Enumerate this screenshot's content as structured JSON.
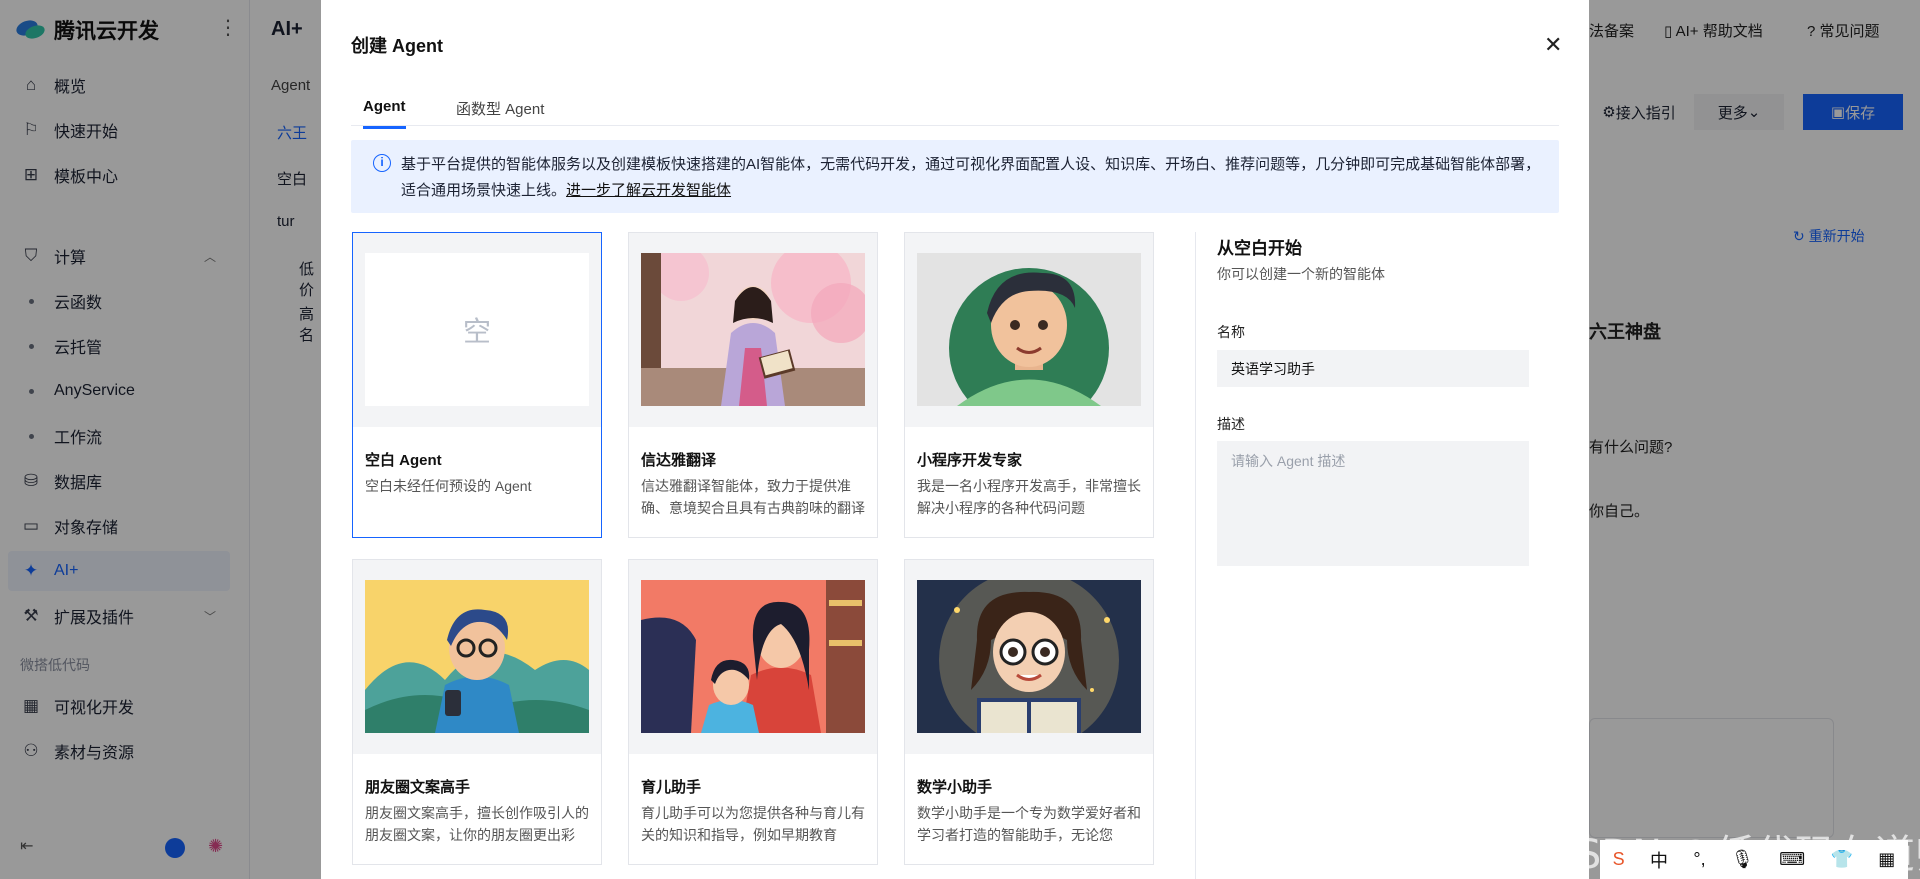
{
  "sidebar": {
    "brand": "腾讯云开发",
    "items": [
      {
        "label": "概览",
        "icon": "home-icon"
      },
      {
        "label": "快速开始",
        "icon": "flag-icon"
      },
      {
        "label": "模板中心",
        "icon": "grid-icon"
      },
      {
        "label": "计算",
        "icon": "shield-icon"
      },
      {
        "label": "云函数"
      },
      {
        "label": "云托管"
      },
      {
        "label": "AnyService"
      },
      {
        "label": "工作流"
      },
      {
        "label": "数据库",
        "icon": "database-icon"
      },
      {
        "label": "对象存储",
        "icon": "folder-icon"
      },
      {
        "label": "AI+",
        "icon": "sparkle-icon"
      },
      {
        "label": "扩展及插件",
        "icon": "plugin-icon"
      },
      {
        "label": "可视化开发",
        "icon": "calendar-icon"
      },
      {
        "label": "素材与资源",
        "icon": "people-icon"
      }
    ],
    "group_label": "微搭低代码"
  },
  "col2": {
    "title": "AI+",
    "section": "Agent",
    "items": [
      "六王",
      "空白",
      "tur",
      "低价",
      "高名"
    ]
  },
  "rightbg": {
    "links": [
      "法备案",
      "AI+ 帮助文档",
      "常见问题"
    ],
    "guide": "接入指引",
    "more": "更多",
    "save": "保存",
    "restart": "重新开始",
    "heading": "六王神盘",
    "q1": "有什么问题?",
    "q2": "你自己。"
  },
  "modal": {
    "title": "创建 Agent",
    "tabs": [
      "Agent",
      "函数型 Agent"
    ],
    "notice": "基于平台提供的智能体服务以及创建模板快速搭建的AI智能体，无需代码开发，通过可视化界面配置人设、知识库、开场白、推荐问题等，几分钟即可完成基础智能体部署，适合通用场景快速上线。",
    "notice_link": "进一步了解云开发智能体",
    "cards": [
      {
        "title": "空白 Agent",
        "desc": "空白未经任何预设的 Agent",
        "placeholder": "空"
      },
      {
        "title": "信达雅翻译",
        "desc": "信达雅翻译智能体，致力于提供准确、意境契合且具有古典韵味的翻译"
      },
      {
        "title": "小程序开发专家",
        "desc": "我是一名小程序开发高手，非常擅长解决小程序的各种代码问题"
      },
      {
        "title": "朋友圈文案高手",
        "desc": "朋友圈文案高手，擅长创作吸引人的朋友圈文案，让你的朋友圈更出彩"
      },
      {
        "title": "育儿助手",
        "desc": "育儿助手可以为您提供各种与育儿有关的知识和指导，例如早期教育"
      },
      {
        "title": "数学小助手",
        "desc": "数学小助手是一个专为数学爱好者和学习者打造的智能助手，无论您"
      }
    ],
    "form": {
      "title": "从空白开始",
      "subtitle": "你可以创建一个新的智能体",
      "name_label": "名称",
      "name_value": "英语学习助手",
      "desc_label": "描述",
      "desc_placeholder": "请输入 Agent 描述"
    }
  },
  "watermark": "CSDN @低代码布道师",
  "taskbar": [
    "中"
  ]
}
